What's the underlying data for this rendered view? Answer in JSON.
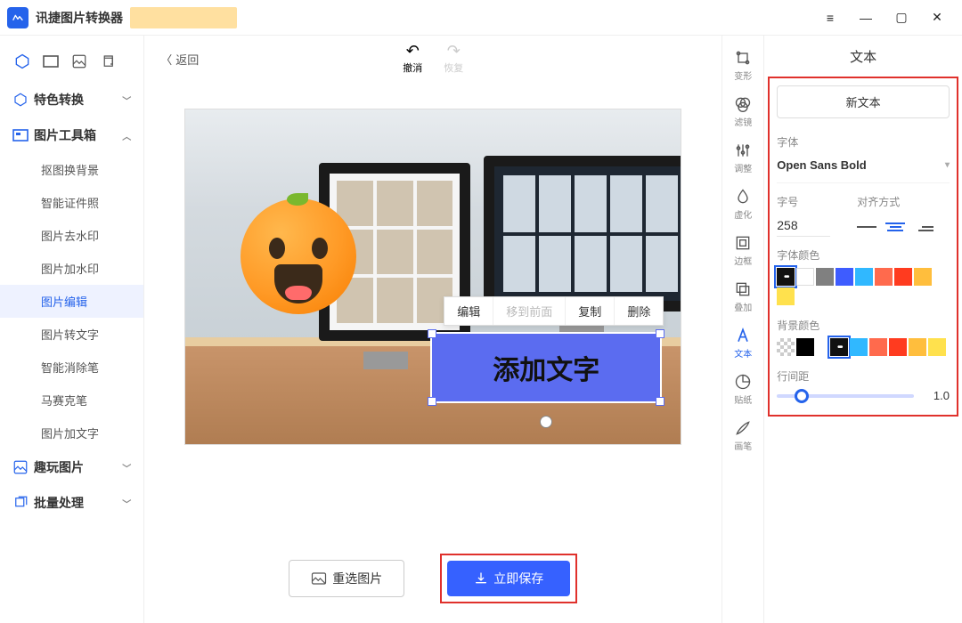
{
  "app_title": "讯捷图片转换器",
  "window_controls": {
    "menu": "≡",
    "min": "—",
    "max": "▢",
    "close": "✕"
  },
  "sidebar": {
    "categories": [
      {
        "key": "special",
        "label": "特色转换",
        "expanded": false
      },
      {
        "key": "toolbox",
        "label": "图片工具箱",
        "expanded": true,
        "items": [
          "抠图换背景",
          "智能证件照",
          "图片去水印",
          "图片加水印",
          "图片编辑",
          "图片转文字",
          "智能消除笔",
          "马赛克笔",
          "图片加文字"
        ],
        "active_index": 4
      },
      {
        "key": "fun",
        "label": "趣玩图片",
        "expanded": false
      },
      {
        "key": "batch",
        "label": "批量处理",
        "expanded": false
      }
    ]
  },
  "canvas": {
    "back": "返回",
    "undo": "撤消",
    "redo": "恢复",
    "overlay_text": "添加文字",
    "ctx": {
      "edit": "编辑",
      "front": "移到前面",
      "copy": "复制",
      "delete": "删除"
    },
    "btn_reselect": "重选图片",
    "btn_save": "立即保存"
  },
  "rail": [
    {
      "key": "transform",
      "label": "变形"
    },
    {
      "key": "filter",
      "label": "滤镜"
    },
    {
      "key": "adjust",
      "label": "调整"
    },
    {
      "key": "blur",
      "label": "虚化"
    },
    {
      "key": "border",
      "label": "边框"
    },
    {
      "key": "overlay",
      "label": "叠加"
    },
    {
      "key": "text",
      "label": "文本",
      "active": true
    },
    {
      "key": "sticker",
      "label": "贴纸"
    },
    {
      "key": "brush",
      "label": "画笔"
    }
  ],
  "text_panel": {
    "title": "文本",
    "new_text": "新文本",
    "font_label": "字体",
    "font_value": "Open Sans Bold",
    "size_label": "字号",
    "size_value": "258",
    "align_label": "对齐方式",
    "align_selected": 1,
    "font_color_label": "字体颜色",
    "font_colors": [
      "more",
      "#ffffff",
      "#808080",
      "#3e5cff",
      "#30b8ff",
      "#ff6a4d",
      "#ff3b1f",
      "#ffbe3d",
      "#ffe14d"
    ],
    "font_color_selected": 0,
    "bg_color_label": "背景颜色",
    "bg_colors": [
      "checker",
      "#000000",
      "spacer",
      "more",
      "#30b8ff",
      "#ff6a4d",
      "#ff3b1f",
      "#ffbe3d",
      "#ffe14d"
    ],
    "bg_color_selected": 3,
    "line_height_label": "行间距",
    "line_height_value": "1.0",
    "line_height_pos": 18
  }
}
